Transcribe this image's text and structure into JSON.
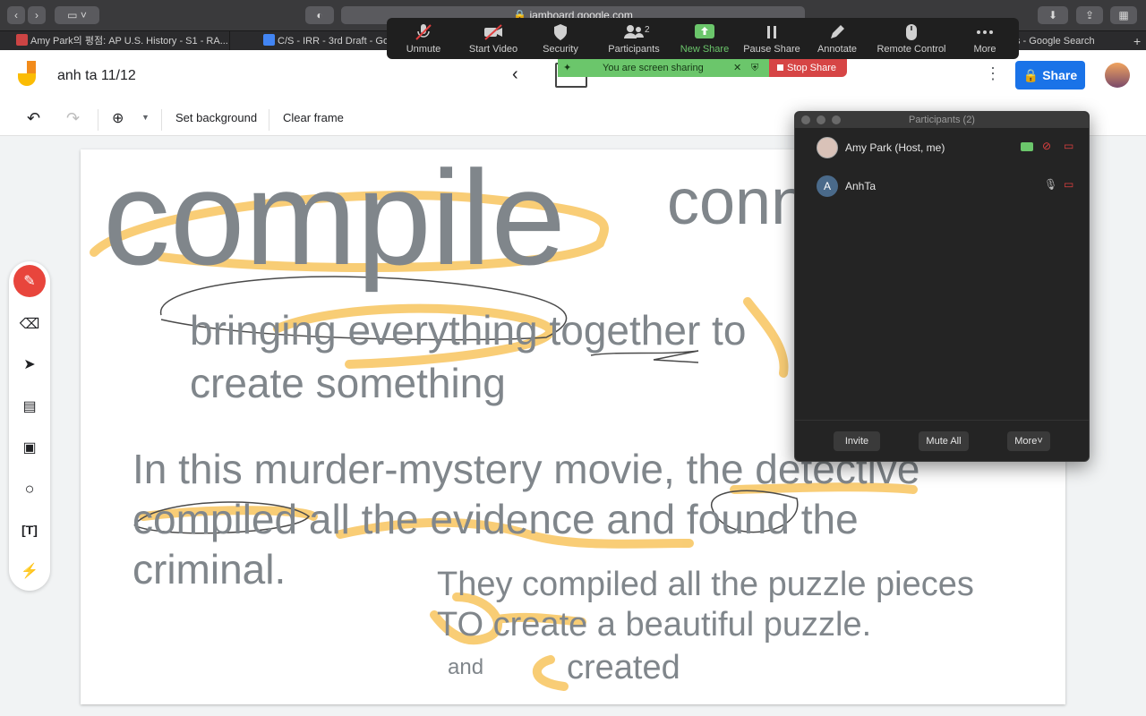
{
  "browser": {
    "url": "jamboard.google.com",
    "tabs": [
      {
        "label": "Amy Park의 평점: AP U.S. History - S1 - RA..."
      },
      {
        "label": "C/S - IRR - 3rd Draft - Goo"
      },
      {
        "label": "s - Google Search"
      }
    ]
  },
  "zoom": {
    "toolbar": [
      {
        "label": "Unmute",
        "icon": "mic-muted-icon"
      },
      {
        "label": "Start Video",
        "icon": "video-off-icon"
      },
      {
        "label": "Security",
        "icon": "shield-icon"
      },
      {
        "label": "Participants",
        "icon": "people-icon",
        "count": "2"
      },
      {
        "label": "New Share",
        "icon": "share-up-icon"
      },
      {
        "label": "Pause Share",
        "icon": "pause-icon"
      },
      {
        "label": "Annotate",
        "icon": "pencil-icon"
      },
      {
        "label": "Remote Control",
        "icon": "mouse-icon"
      },
      {
        "label": "More",
        "icon": "more-dots-icon"
      }
    ],
    "sharing_status": "You are screen sharing",
    "stop_share": "Stop Share",
    "participants_panel": {
      "title": "Participants (2)",
      "participants": [
        {
          "name": "Amy Park (Host, me)",
          "initial": ""
        },
        {
          "name": "AnhTa",
          "initial": "A"
        }
      ],
      "buttons": {
        "invite": "Invite",
        "mute_all": "Mute All",
        "more": "More"
      }
    }
  },
  "jamboard": {
    "title": "anh ta 11/12",
    "share_label": "Share",
    "toolbar": {
      "set_background": "Set background",
      "clear_frame": "Clear frame"
    },
    "canvas": {
      "word": "compile",
      "word2": "conn",
      "definition_line1": "bringing everything together to",
      "definition_line2": "create something",
      "sentence_line1": "In this murder-mystery movie, the detective",
      "sentence_line2": "compiled all the evidence and found the",
      "sentence_line3": "criminal.",
      "example_line1": "They compiled all the puzzle pieces",
      "example_line2": "TO create a beautiful puzzle.",
      "note_and": "and",
      "note_created": "created"
    }
  },
  "colors": {
    "accent_blue": "#1a73e8",
    "highlighter": "#f6b83c",
    "pen_red": "#e8453c",
    "zoom_green": "#6bc66b",
    "stop_red": "#d64545"
  }
}
